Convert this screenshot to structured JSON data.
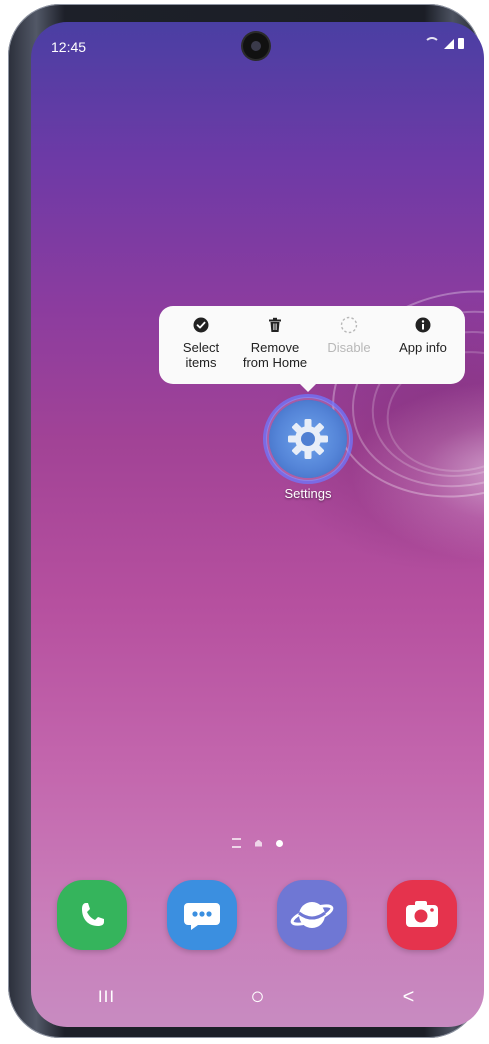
{
  "status_bar": {
    "time": "12:45"
  },
  "context_menu": {
    "items": [
      {
        "label": "Select\nitems",
        "icon": "check-circle-icon",
        "enabled": true
      },
      {
        "label": "Remove\nfrom Home",
        "icon": "trash-icon",
        "enabled": true
      },
      {
        "label": "Disable",
        "icon": "dashed-circle-icon",
        "enabled": false
      },
      {
        "label": "App info",
        "icon": "info-icon",
        "enabled": true
      }
    ]
  },
  "home_app": {
    "label": "Settings",
    "icon": "gear-icon"
  },
  "dock": {
    "apps": [
      {
        "icon": "phone-icon",
        "color": "#35b45c"
      },
      {
        "icon": "messages-icon",
        "color": "#3b8fe0"
      },
      {
        "icon": "internet-icon",
        "color": "#6f77d4"
      },
      {
        "icon": "camera-icon",
        "color": "#e5334d"
      }
    ]
  },
  "nav_bar": {
    "recents_symbol": "III",
    "home_symbol": "○",
    "back_symbol": "<"
  }
}
